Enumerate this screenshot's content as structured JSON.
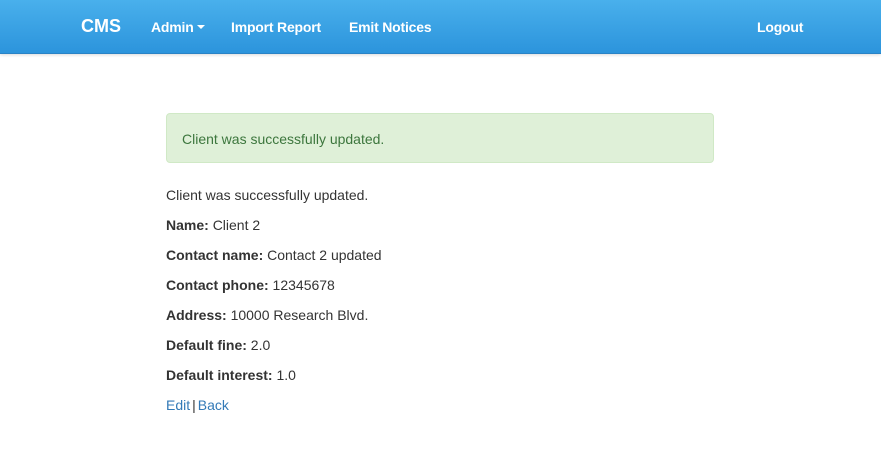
{
  "navbar": {
    "brand": "CMS",
    "items": [
      {
        "label": "Admin"
      },
      {
        "label": "Import Report"
      },
      {
        "label": "Emit Notices"
      }
    ],
    "logout": "Logout",
    "colors": {
      "top": "#49b0ec",
      "bottom": "#2c94dc"
    }
  },
  "alert": {
    "message": "Client was successfully updated.",
    "colors": {
      "background": "#dff0d8",
      "text": "#3c763d"
    }
  },
  "notice": "Client was successfully updated.",
  "client": {
    "name_label": "Name:",
    "name": "Client 2",
    "contact_name_label": "Contact name:",
    "contact_name": "Contact 2 updated",
    "contact_phone_label": "Contact phone:",
    "contact_phone": "12345678",
    "address_label": "Address:",
    "address": "10000 Research Blvd.",
    "default_fine_label": "Default fine:",
    "default_fine": "2.0",
    "default_interest_label": "Default interest:",
    "default_interest": "1.0"
  },
  "actions": {
    "edit": "Edit",
    "separator": "|",
    "back": "Back"
  },
  "link_color": "#337ab7"
}
